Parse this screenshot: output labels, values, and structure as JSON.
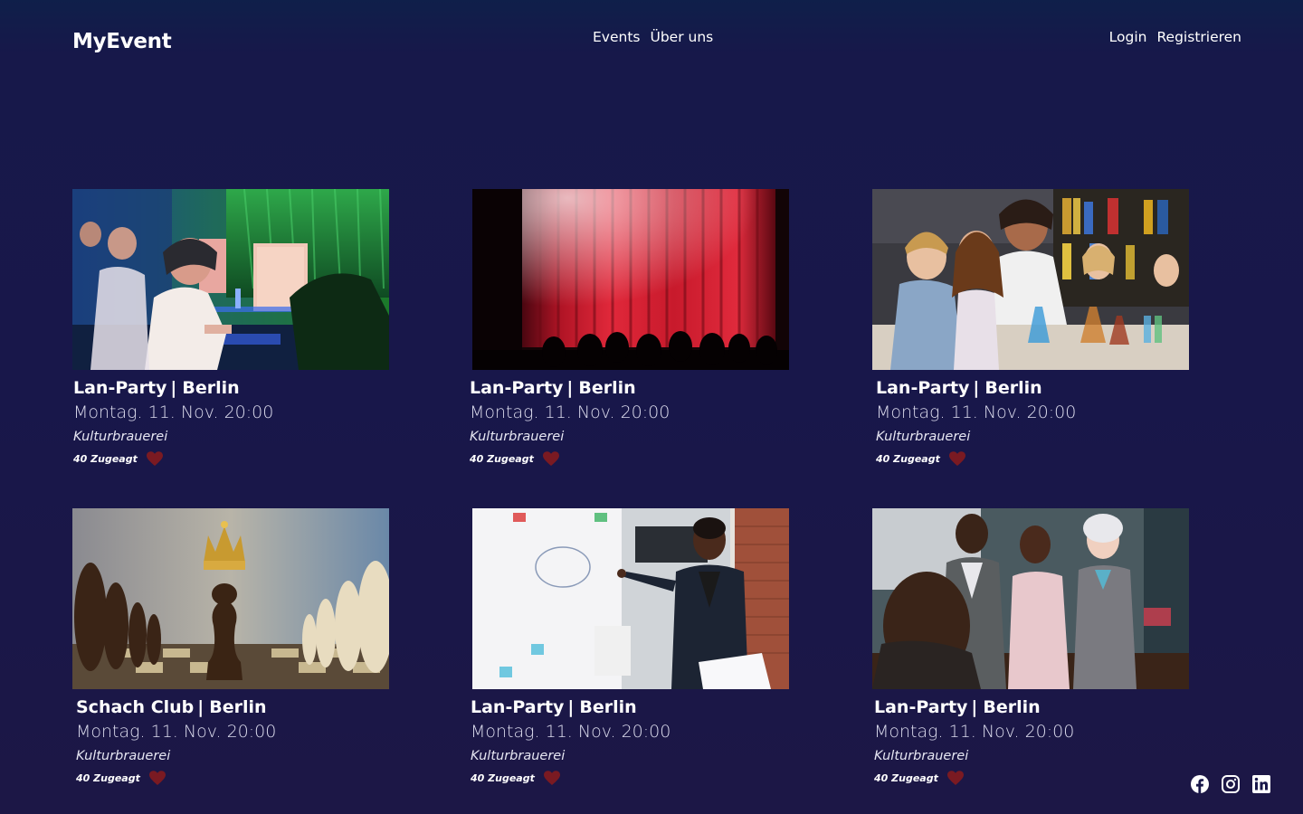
{
  "header": {
    "logo": "MyEvent",
    "nav": {
      "events": "Events",
      "about": "Über uns"
    },
    "auth": {
      "login": "Login",
      "register": "Registrieren"
    }
  },
  "events": [
    {
      "title": "Lan-Party",
      "separator": "|",
      "city": "Berlin",
      "date": "Montag. 11. Nov. 20:00",
      "venue": "Kulturbrauerei",
      "attendees": "40 Zugeagt",
      "image": "lan-party-photo"
    },
    {
      "title": "Lan-Party",
      "separator": "|",
      "city": "Berlin",
      "date": "Montag. 11. Nov. 20:00",
      "venue": "Kulturbrauerei",
      "attendees": "40 Zugeagt",
      "image": "theater-curtain-photo"
    },
    {
      "title": "Lan-Party",
      "separator": "|",
      "city": "Berlin",
      "date": "Montag. 11. Nov. 20:00",
      "venue": "Kulturbrauerei",
      "attendees": "40 Zugeagt",
      "image": "science-class-photo"
    },
    {
      "title": "Schach Club",
      "separator": "|",
      "city": "Berlin",
      "date": "Montag. 11. Nov. 20:00",
      "venue": "Kulturbrauerei",
      "attendees": "40 Zugeagt",
      "image": "chess-photo"
    },
    {
      "title": "Lan-Party",
      "separator": "|",
      "city": "Berlin",
      "date": "Montag. 11. Nov. 20:00",
      "venue": "Kulturbrauerei",
      "attendees": "40 Zugeagt",
      "image": "whiteboard-presentation-photo"
    },
    {
      "title": "Lan-Party",
      "separator": "|",
      "city": "Berlin",
      "date": "Montag. 11. Nov. 20:00",
      "venue": "Kulturbrauerei",
      "attendees": "40 Zugeagt",
      "image": "business-meeting-photo"
    }
  ],
  "social": {
    "icons": [
      "facebook-icon",
      "instagram-icon",
      "linkedin-icon"
    ]
  },
  "colors": {
    "background": "#18174a",
    "heart": "#7a1a22",
    "text": "#ffffff"
  }
}
